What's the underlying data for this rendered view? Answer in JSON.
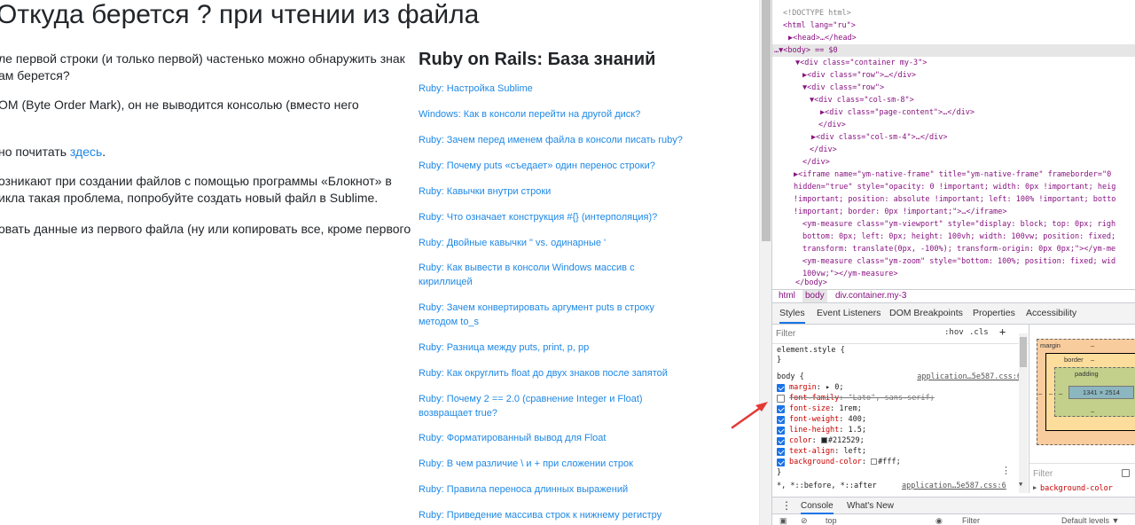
{
  "page": {
    "title": "Откуда берется ? при чтении из файла",
    "paragraphs": [
      "ле первой строки (и только первой) частенько можно обнаружить знак",
      "ам берется?",
      "OM (Byte Order Mark), он не выводится консолью (вместо него",
      "но почитать",
      "здесь",
      ".",
      "озникают при создании файлов с помощью программы «Блокнот» в",
      "икла такая проблема, попробуйте создать новый файл в Sublime.",
      "овать данные из первого файла (ну или копировать все, кроме первого"
    ]
  },
  "sidebar": {
    "title": "Ruby on Rails: База знаний",
    "links": [
      "Ruby: Настройка Sublime",
      "Windows: Как в консоли перейти на другой диск?",
      "Ruby: Зачем перед именем файла в консоли писать ruby?",
      "Ruby: Почему puts «съедает» один перенос строки?",
      "Ruby: Кавычки внутри строки",
      "Ruby: Что означает конструкция #{} (интерполяция)?",
      "Ruby: Двойные кавычки \" vs. одинарные '",
      "Ruby: Как вывести в консоли Windows массив с кириллицей",
      "Ruby: Зачем конвертировать аргумент puts в строку методом to_s",
      "Ruby: Разница между puts, print, p, pp",
      "Ruby: Как округлить float до двух знаков после запятой",
      "Ruby: Почему 2 == 2.0 (сравнение Integer и Float) возвращает true?",
      "Ruby: Форматированный вывод для Float",
      "Ruby: В чем различие \\ и + при сложении строк",
      "Ruby: Правила переноса длинных выражений",
      "Ruby: Приведение массива строк к нижнему регистру"
    ]
  },
  "devtools": {
    "dom": [
      "<!DOCTYPE html>",
      "<html lang=\"ru\">",
      "▶<head>…</head>",
      "…▼<body> == $0",
      "▼<div class=\"container my-3\">",
      "▶<div class=\"row\">…</div>",
      "▼<div class=\"row\">",
      "▼<div class=\"col-sm-8\">",
      "▶<div class=\"page-content\">…</div>",
      "</div>",
      "▶<div class=\"col-sm-4\">…</div>",
      "</div>",
      "</div>",
      "▶<iframe name=\"ym-native-frame\" title=\"ym-native-frame\" frameborder=\"0",
      "hidden=\"true\" style=\"opacity: 0 !important; width: 0px !important; heig",
      "!important; position: absolute !important; left: 100% !important; botto",
      "!important; border: 0px !important;\">…</iframe>",
      "<ym-measure class=\"ym-viewport\" style=\"display: block; top: 0px; righ",
      "bottom: 0px; left: 0px; height: 100vh; width: 100vw; position: fixed;",
      "transform: translate(0px, -100%); transform-origin: 0px 0px;\"></ym-me",
      "<ym-measure class=\"ym-zoom\" style=\"bottom: 100%; position: fixed; wid",
      "100vw;\"></ym-measure>",
      "</body>"
    ],
    "breadcrumbs": [
      "html",
      "body",
      "div.container.my-3"
    ],
    "tabs": [
      "Styles",
      "Event Listeners",
      "DOM Breakpoints",
      "Properties",
      "Accessibility"
    ],
    "styles": {
      "filter_placeholder": "Filter",
      "hov": ":hov",
      "cls": ".cls",
      "plus": "+",
      "element_style": "element.style {",
      "element_style_close": "}",
      "rule_selector": "body {",
      "rule_source": "application…5e587.css:6",
      "rule_close": "}",
      "declarations": [
        {
          "name": "margin",
          "value": "▸ 0;",
          "checked": true
        },
        {
          "name": "font-family",
          "value": "\"Lato\", sans-serif;",
          "checked": false
        },
        {
          "name": "font-size",
          "value": "1rem;",
          "checked": true
        },
        {
          "name": "font-weight",
          "value": "400;",
          "checked": true
        },
        {
          "name": "line-height",
          "value": "1.5;",
          "checked": true
        },
        {
          "name": "color",
          "value": "#212529;",
          "checked": true,
          "swatch": "#212529"
        },
        {
          "name": "text-align",
          "value": "left;",
          "checked": true
        },
        {
          "name": "background-color",
          "value": "#fff;",
          "checked": true,
          "swatch": "#ffffff"
        }
      ],
      "next_selector": "*, *::before, *::after",
      "next_source": "application…5e587.css:6"
    },
    "box_model": {
      "margin": "margin",
      "margin_value": "–",
      "border": "border",
      "border_value": "–",
      "padding": "padding",
      "padding_value": "–",
      "content": "1341 × 2514",
      "side_dash": "–",
      "filter": "Filter",
      "computed_prop": "background-color"
    },
    "drawer": {
      "tabs": [
        "Console",
        "What's New"
      ],
      "context": "top",
      "filter": "Filter",
      "levels": "Default levels ▼"
    }
  },
  "colors": {
    "link": "#1e88e5",
    "text": "#212529",
    "arrow": "#e53935"
  }
}
